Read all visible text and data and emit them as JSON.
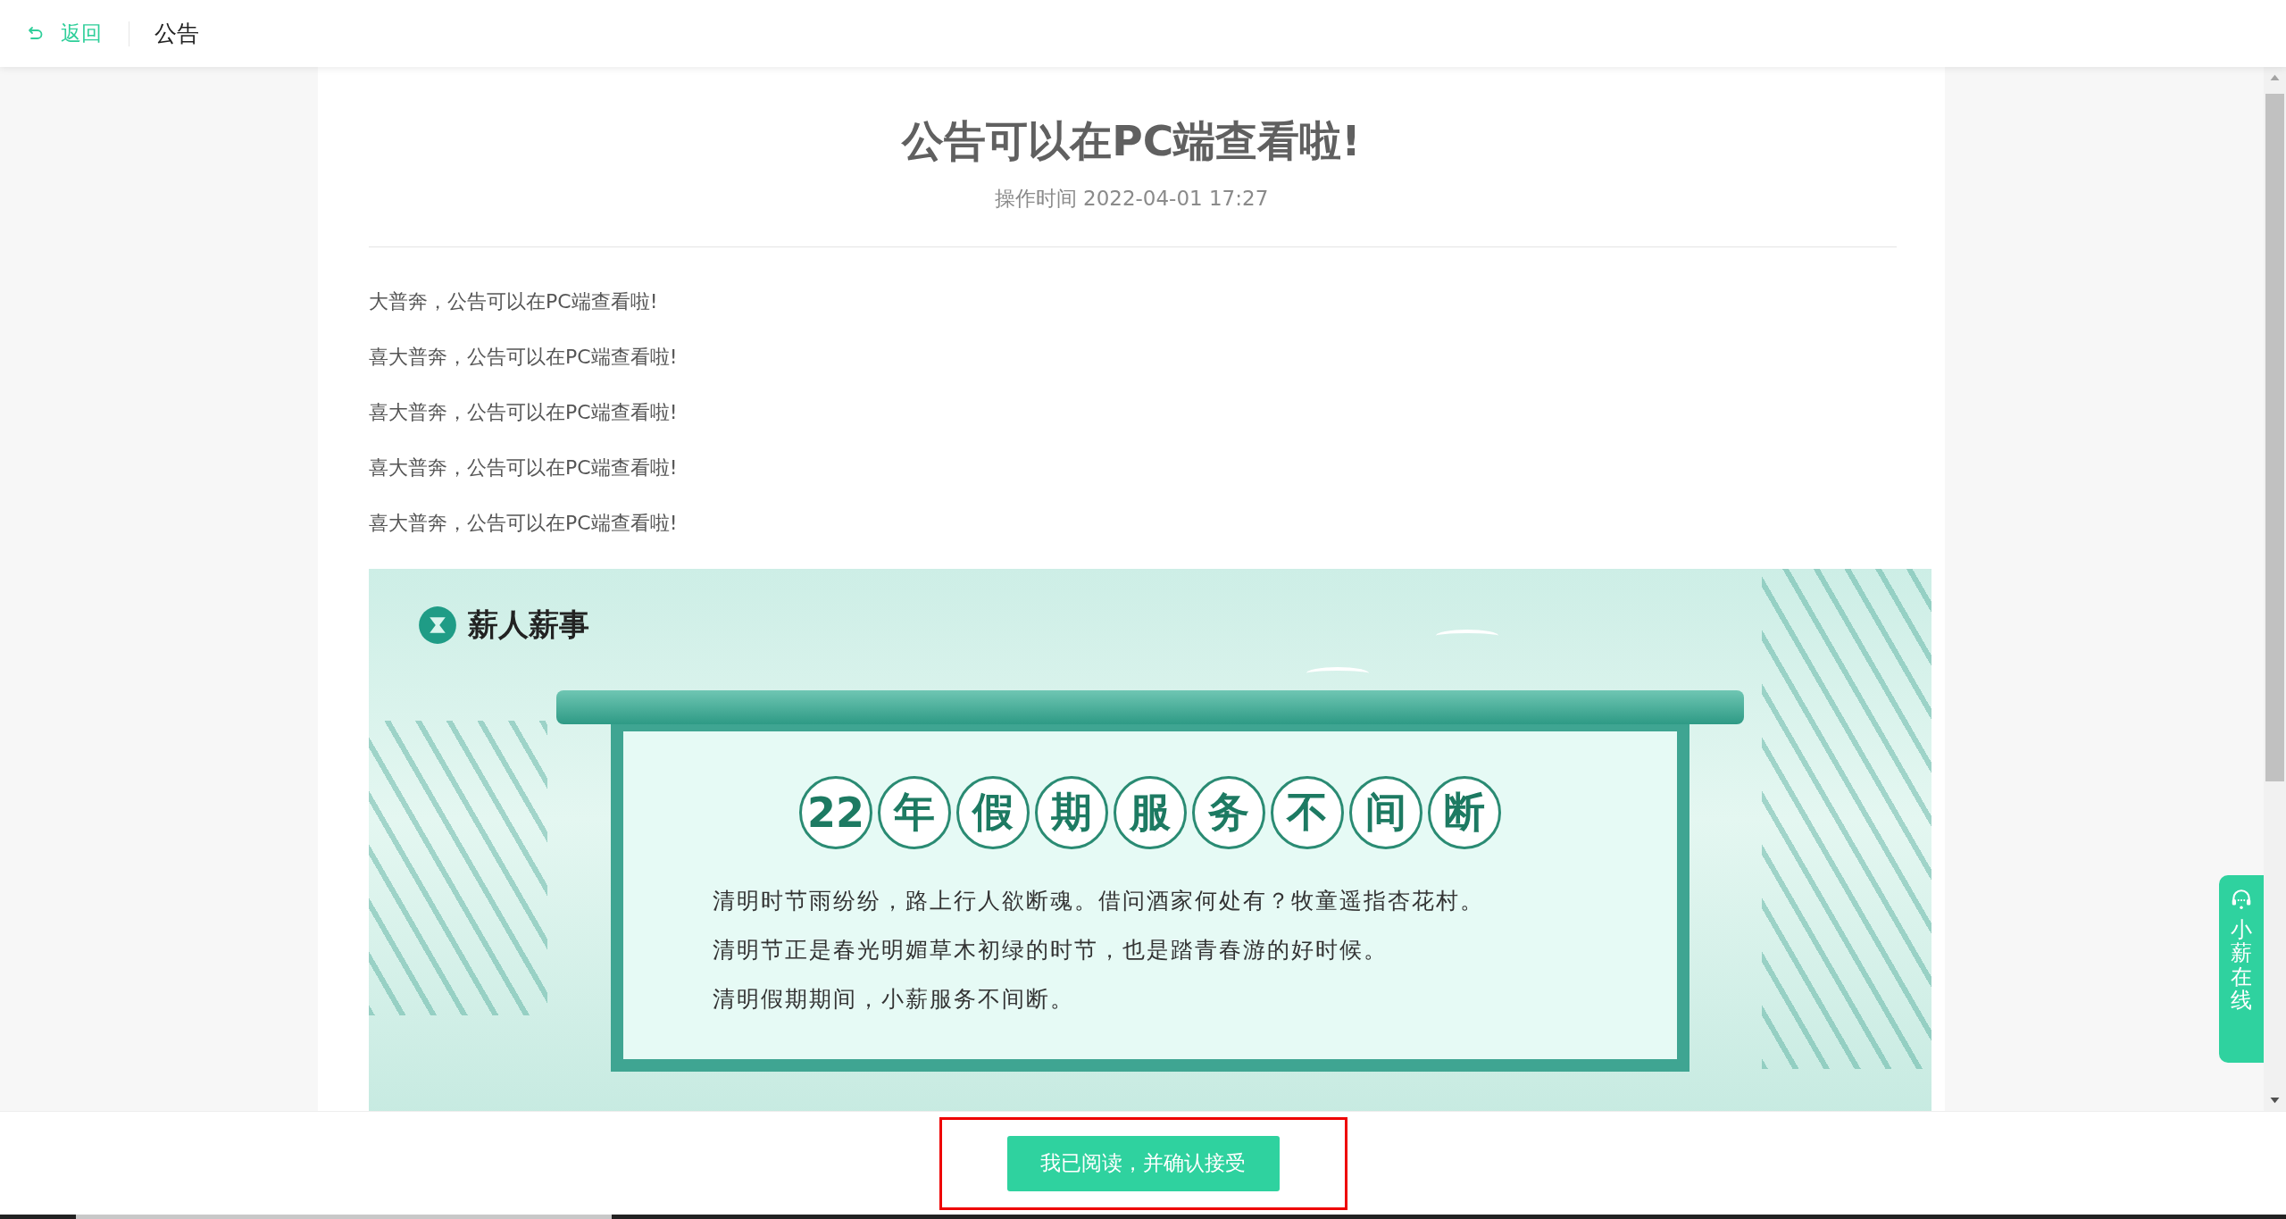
{
  "header": {
    "back_label": "返回",
    "title": "公告"
  },
  "notice": {
    "title": "公告可以在PC端查看啦!",
    "meta": "操作时间 2022-04-01 17:27",
    "paragraphs": [
      "大普奔，公告可以在PC端查看啦!",
      "喜大普奔，公告可以在PC端查看啦!",
      "喜大普奔，公告可以在PC端查看啦!",
      "喜大普奔，公告可以在PC端查看啦!",
      "喜大普奔，公告可以在PC端查看啦!"
    ],
    "banner": {
      "brand": "薪人薪事",
      "headline": [
        "22",
        "年",
        "假",
        "期",
        "服",
        "务",
        "不",
        "间",
        "断"
      ],
      "lines": [
        "清明时节雨纷纷，路上行人欲断魂。借问酒家何处有？牧童遥指杏花村。",
        "清明节正是春光明媚草木初绿的时节，也是踏青春游的好时候。",
        "清明假期期间，小薪服务不间断。"
      ]
    }
  },
  "chat_widget": {
    "label": "小薪在线"
  },
  "footer": {
    "accept_button": "我已阅读，并确认接受",
    "highlighted": true
  }
}
